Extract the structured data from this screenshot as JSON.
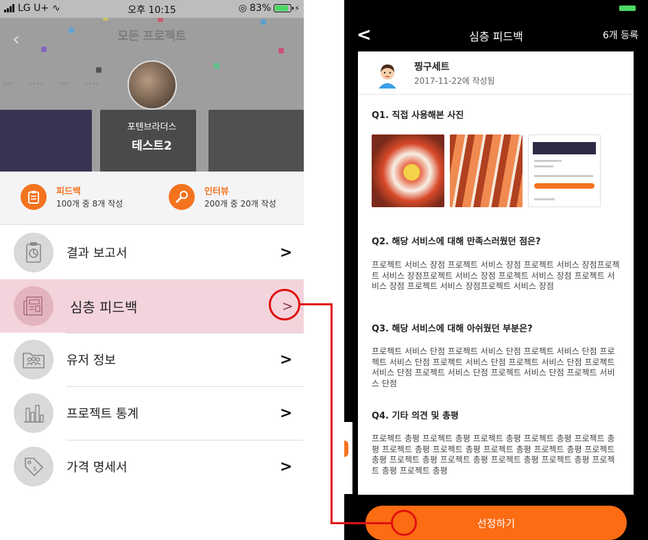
{
  "left_screen": {
    "status_bar": {
      "carrier": "LG U+",
      "time": "오후 10:15",
      "battery": "83%",
      "battery_level": 0.83
    },
    "header": {
      "title": "모든 프로젝트"
    },
    "profile": {
      "user_name": "포텐브라더스",
      "project_name": "테스트2"
    },
    "stats": [
      {
        "title": "피드백",
        "detail": "100개 중 8개 작성",
        "icon": "clipboard-icon"
      },
      {
        "title": "인터뷰",
        "detail": "200개 중 20개 작성",
        "icon": "microphone-icon"
      }
    ],
    "menu": [
      {
        "label": "결과 보고서",
        "icon": "report-chart-icon",
        "active": false
      },
      {
        "label": "심층 피드백",
        "icon": "newspaper-icon",
        "active": true
      },
      {
        "label": "유저 정보",
        "icon": "users-folder-icon",
        "active": false
      },
      {
        "label": "프로젝트 통계",
        "icon": "bar-chart-icon",
        "active": false
      },
      {
        "label": "가격 명세서",
        "icon": "price-tag-icon",
        "active": false
      }
    ]
  },
  "right_screen": {
    "nav": {
      "title": "심층 피드백",
      "count": "6개 등록"
    },
    "feedback": {
      "author": "찡구세트",
      "date": "2017-11-22에 작성됨",
      "q1": "Q1. 직접 사용해본 사진",
      "q2": "Q2. 해당 서비스에 대해 만족스러웠던 점은?",
      "a2": "프로젝트 서비스 장점 프로젝트 서비스 장점 프로젝트 서비스 장점프로젝트 서비스 장점프로젝트 서비스 장점 프로젝트 서비스 장점 프로젝트 서비스 장점 프로젝트 서비스 장점프로젝트 서비스 장점",
      "q3": "Q3. 해당 서비스에 대해 아쉬웠던 부분은?",
      "a3": "프로젝트 서비스 단점 프로젝트 서비스 단점 프로젝트 서비스 단점 프로젝트 서비스 단점 프로젝트 서비스 단점 프로젝트 서비스 단점 프로젝트 서비스 단점 프로젝트 서비스 단점 프로젝트 서비스 단점 프로젝트 서비스 단점",
      "q4": "Q4. 기타 의견 및 총평",
      "a4": "프로젝트 총평 프로젝트 총평 프로젝트 총평 프로젝트 총평 프로젝트 총평 프로젝트 총평 프로젝트 총평 프로젝트 총평 프로젝트 총평 프로젝트 총평 프로젝트 총평 프로젝트 총평 프로젝트 총평 프로젝트 총평 프로젝트 총평 프로젝트 총평"
    },
    "select_button": "선정하기"
  },
  "colors": {
    "accent": "#fb6c13",
    "highlight_row": "#f4d4dc",
    "annotation": "#e01010"
  }
}
